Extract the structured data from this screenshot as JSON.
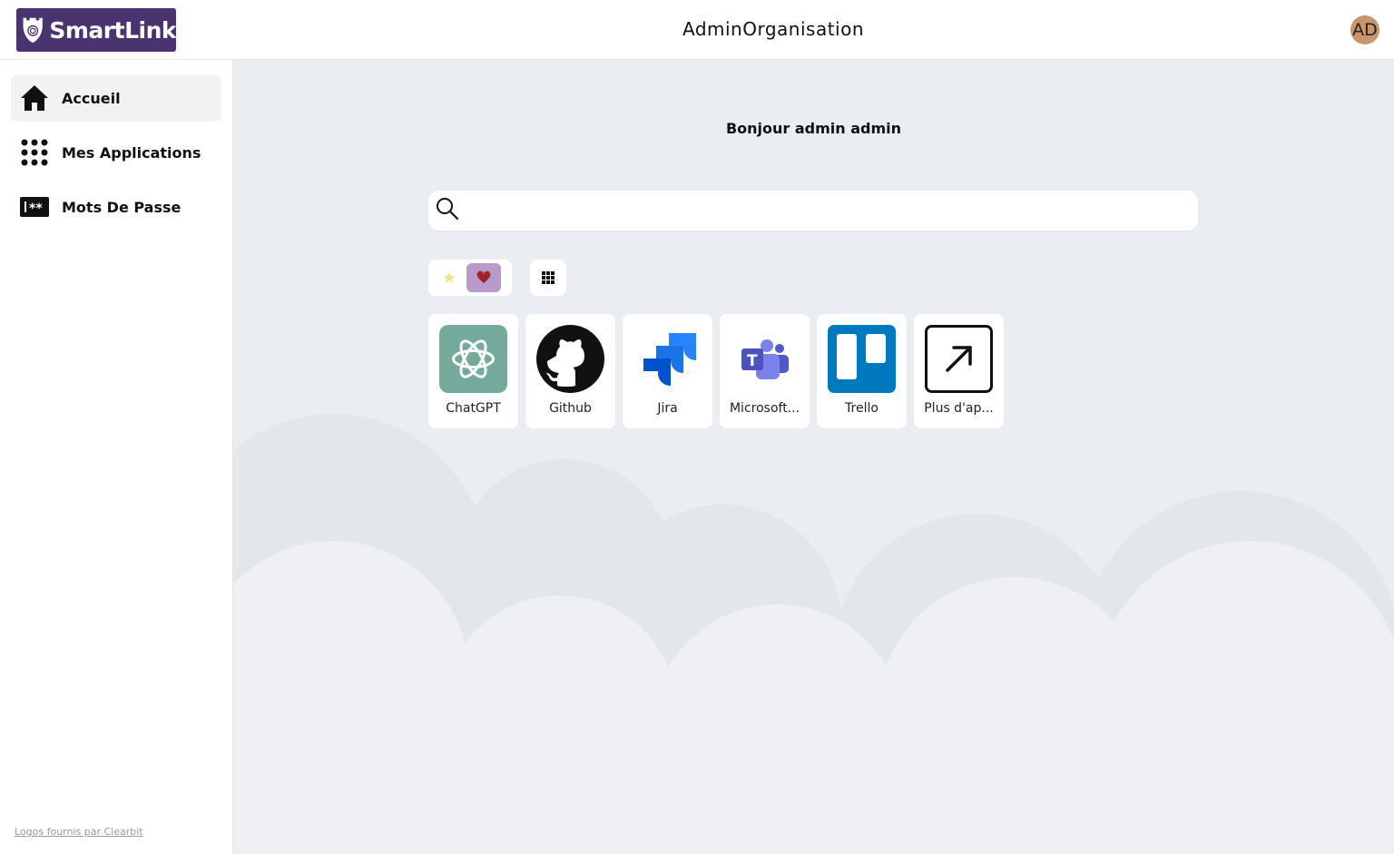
{
  "header": {
    "brand": "SmartLink",
    "org_name": "AdminOrganisation",
    "avatar_initials": "AD"
  },
  "sidebar": {
    "items": [
      {
        "label": "Accueil",
        "icon": "home-icon",
        "active": true
      },
      {
        "label": "Mes Applications",
        "icon": "apps-grid-icon",
        "active": false
      },
      {
        "label": "Mots De Passe",
        "icon": "password-icon",
        "active": false
      }
    ],
    "footer_link": "Logos fournis par Clearbit"
  },
  "main": {
    "greeting": "Bonjour admin admin",
    "search": {
      "placeholder": "",
      "value": ""
    },
    "filters": [
      {
        "icon": "star-icon",
        "active": false
      },
      {
        "icon": "heart-icon",
        "active": true
      }
    ],
    "view_toggle_icon": "grid-icon",
    "apps": [
      {
        "name": "ChatGPT",
        "icon": "chatgpt-logo"
      },
      {
        "name": "Github",
        "icon": "github-logo"
      },
      {
        "name": "Jira",
        "icon": "jira-logo"
      },
      {
        "name": "Microsoft...",
        "icon": "microsoft-teams-logo"
      },
      {
        "name": "Trello",
        "icon": "trello-logo"
      },
      {
        "name": "Plus d'ap...",
        "icon": "external-link-icon"
      }
    ]
  },
  "colors": {
    "brand": "#4a3470",
    "background": "#eaeef2",
    "active_filter": "#b89bc9",
    "heart": "#a0242a",
    "star": "#f5e08a"
  }
}
